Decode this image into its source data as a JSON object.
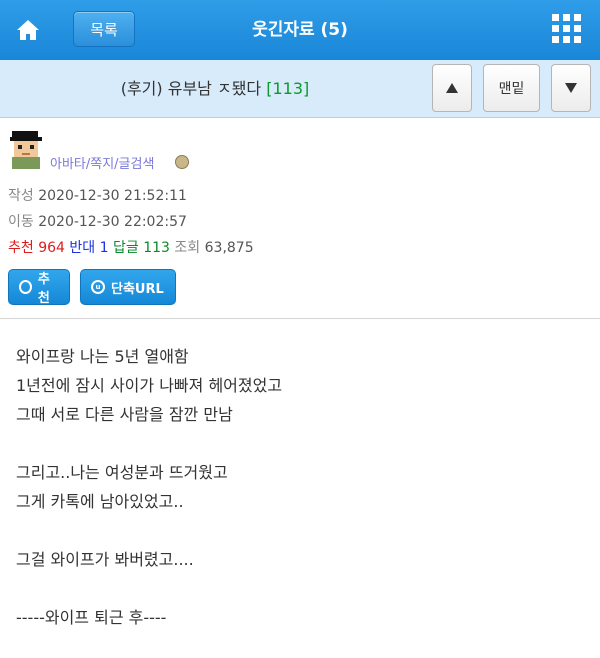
{
  "header": {
    "list_label": "목록",
    "title": "웃긴자료 (5)"
  },
  "post": {
    "title": "(후기) 유부남 ㅈ됐다",
    "comment_count": "[113]",
    "nav_bottom_label": "맨밑"
  },
  "author": {
    "links": "아바타/쪽지/글검색"
  },
  "meta": {
    "written_label": "작성",
    "written": "2020-12-30 21:52:11",
    "moved_label": "이동",
    "moved": "2020-12-30 22:02:57",
    "rec_label": "추천",
    "rec": "964",
    "opp_label": "반대",
    "opp": "1",
    "reply_label": "답글",
    "reply": "113",
    "views_label": "조회",
    "views": "63,875"
  },
  "actions": {
    "recommend": "추천",
    "short_url": "단축URL"
  },
  "content": {
    "lines": [
      "와이프랑 나는 5년 열애함",
      "1년전에 잠시 사이가 나빠져 헤어졌었고",
      "그때 서로 다른 사람을 잠깐 만남",
      "",
      "그리고..나는 여성분과 뜨거웠고",
      "그게 카톡에 남아있었고..",
      "",
      "그걸 와이프가 봐버렸고....",
      "",
      "-----와이프 퇴근 후----"
    ]
  }
}
